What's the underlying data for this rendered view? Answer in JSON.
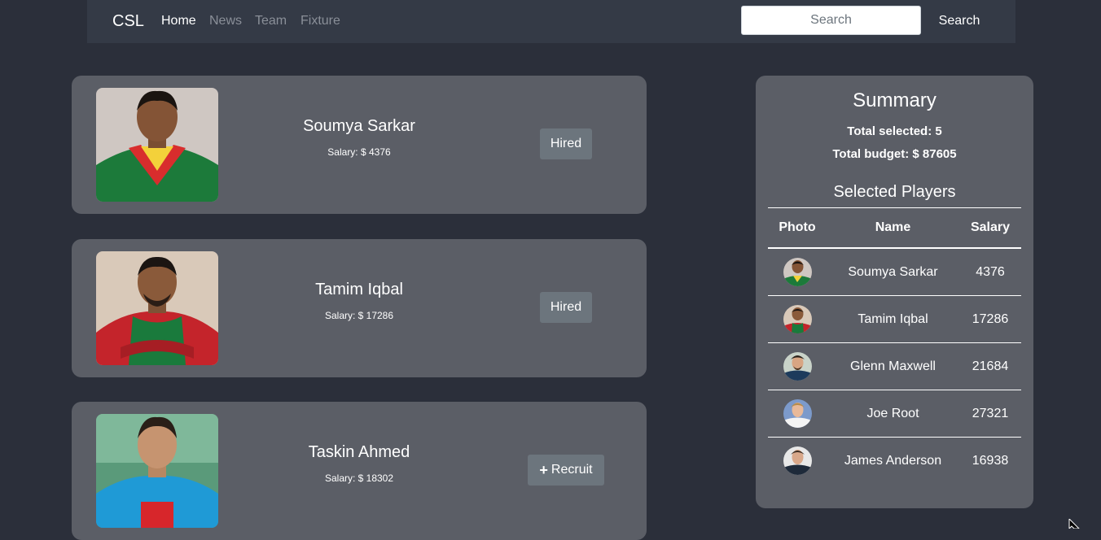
{
  "navbar": {
    "brand": "CSL",
    "links": [
      "Home",
      "News",
      "Team",
      "Fixture"
    ],
    "search_placeholder": "Search",
    "search_button": "Search"
  },
  "players": [
    {
      "name": "Soumya Sarkar",
      "salary": "Salary: $ 4376",
      "action": "Hired",
      "jersey": "green-red-yellow"
    },
    {
      "name": "Tamim Iqbal",
      "salary": "Salary: $ 17286",
      "action": "Hired",
      "jersey": "red-green"
    },
    {
      "name": "Taskin Ahmed",
      "salary": "Salary: $ 18302",
      "action": "Recruit",
      "action_icon": "plus-icon",
      "jersey": "blue"
    }
  ],
  "summary": {
    "title": "Summary",
    "total_selected": "Total selected: 5",
    "total_budget": "Total budget: $ 87605",
    "subtitle": "Selected Players",
    "headers": [
      "Photo",
      "Name",
      "Salary"
    ],
    "rows": [
      {
        "name": "Soumya Sarkar",
        "salary": "4376"
      },
      {
        "name": "Tamim Iqbal",
        "salary": "17286"
      },
      {
        "name": "Glenn Maxwell",
        "salary": "21684"
      },
      {
        "name": "Joe Root",
        "salary": "27321"
      },
      {
        "name": "James Anderson",
        "salary": "16938"
      }
    ]
  },
  "colors": {
    "page_bg": "#2b2f3a",
    "navbar_bg": "#343a46",
    "card_bg": "#5b5e66",
    "button_bg": "#6c757d"
  }
}
